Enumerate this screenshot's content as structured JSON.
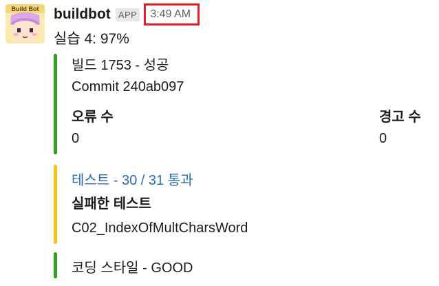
{
  "message": {
    "bot": {
      "name": "buildbot",
      "badge": "APP",
      "avatar_text": "Build Bot"
    },
    "timestamp": "3:49 AM",
    "text": "실습 4: 97%"
  },
  "attachments": [
    {
      "color": "#2ea01f",
      "title": "빌드 1753 - 성공",
      "subtitle": "Commit 240ab097",
      "fields": [
        {
          "title": "오류 수",
          "value": "0"
        },
        {
          "title": "경고 수",
          "value": "0"
        }
      ]
    },
    {
      "color": "#f5c518",
      "title": "테스트 - 30 / 31 통과",
      "field_title": "실패한 테스트",
      "field_value": "C02_IndexOfMultCharsWord"
    },
    {
      "color": "#2ea01f",
      "title": "코딩 스타일 - GOOD"
    }
  ],
  "colors": {
    "success": "#2ea01f",
    "warning": "#f5c518",
    "highlight_box": "#e31e24",
    "link": "#2a6cad"
  }
}
